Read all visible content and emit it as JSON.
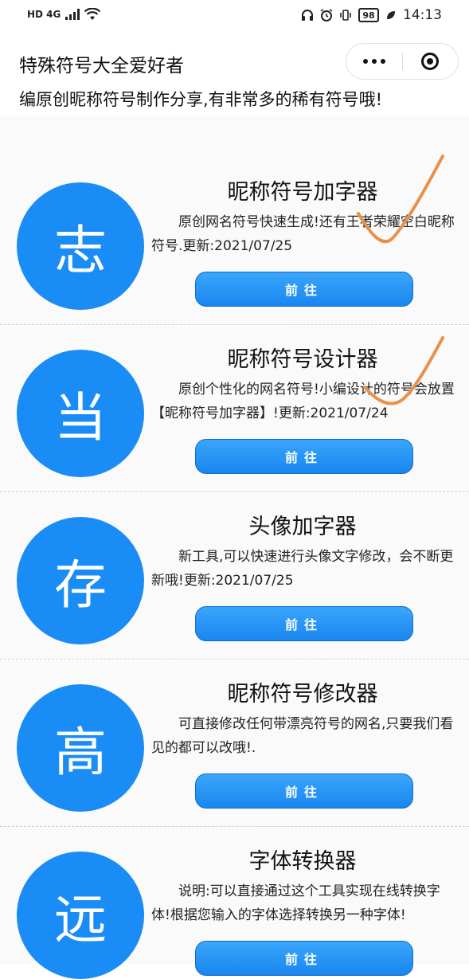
{
  "status_bar": {
    "left": "HD 4G",
    "battery": "98",
    "time": "14:13"
  },
  "header": {
    "title": "特殊符号大全爱好者",
    "subtitle": "编原创昵称符号制作分享,有非常多的稀有符号哦!"
  },
  "cards": [
    {
      "avatar": "志",
      "title": "昵称符号加字器",
      "desc": "原创网名符号快速生成!还有王者荣耀空白昵称符号.更新:2021/07/25",
      "button": "前往"
    },
    {
      "avatar": "当",
      "title": "昵称符号设计器",
      "desc": "原创个性化的网名符号!小编设计的符号会放置【昵称符号加字器】!更新:2021/07/24",
      "button": "前往"
    },
    {
      "avatar": "存",
      "title": "头像加字器",
      "desc": "新工具,可以快速进行头像文字修改，会不断更新哦!更新:2021/07/25",
      "button": "前往"
    },
    {
      "avatar": "高",
      "title": "昵称符号修改器",
      "desc": "可直接修改任何带漂亮符号的网名,只要我们看见的都可以改哦!.",
      "button": "前往"
    },
    {
      "avatar": "远",
      "title": "字体转换器",
      "desc": "说明:可以直接通过这个工具实现在线转换字体!根据您输入的字体选择转换另一种字体!",
      "button": "前往"
    }
  ],
  "colors": {
    "accent": "#1a8cf5",
    "checkmark": "#e8914a"
  },
  "icons": [
    "headphones-icon",
    "alarm-icon",
    "vibrate-icon",
    "battery-icon",
    "leaf-icon",
    "more-icon",
    "close-miniprogram-icon"
  ]
}
